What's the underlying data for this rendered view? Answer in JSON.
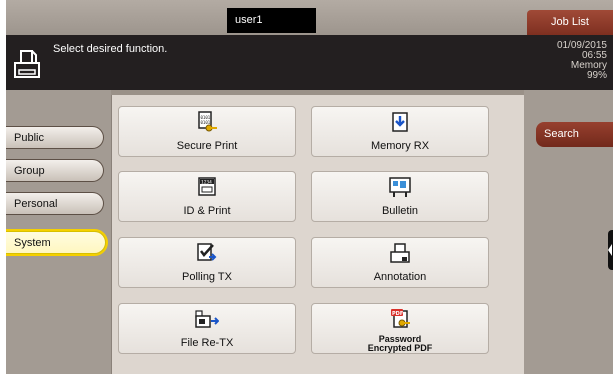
{
  "header": {
    "user": "user1",
    "job_list": "Job List",
    "message": "Select desired function.",
    "date": "01/09/2015",
    "time": "06:55",
    "memory_label": "Memory",
    "memory_value": "99%"
  },
  "tabs": [
    {
      "label": "Public"
    },
    {
      "label": "Group"
    },
    {
      "label": "Personal"
    },
    {
      "label": "System"
    }
  ],
  "functions": [
    {
      "label": "Secure Print",
      "icon": "secure-print-icon"
    },
    {
      "label": "Memory RX",
      "icon": "memory-rx-icon"
    },
    {
      "label": "ID & Print",
      "icon": "id-print-icon"
    },
    {
      "label": "Bulletin",
      "icon": "bulletin-icon"
    },
    {
      "label": "Polling TX",
      "icon": "polling-tx-icon"
    },
    {
      "label": "Annotation",
      "icon": "annotation-icon"
    },
    {
      "label": "File Re-TX",
      "icon": "file-re-tx-icon"
    },
    {
      "label_line1": "Password",
      "label_line2": "Encrypted PDF",
      "icon": "password-pdf-icon"
    }
  ],
  "right": {
    "search": "Search"
  },
  "colors": {
    "accent": "#8a3626",
    "active_tab": "#f5d000",
    "message_bar": "#231f20"
  }
}
